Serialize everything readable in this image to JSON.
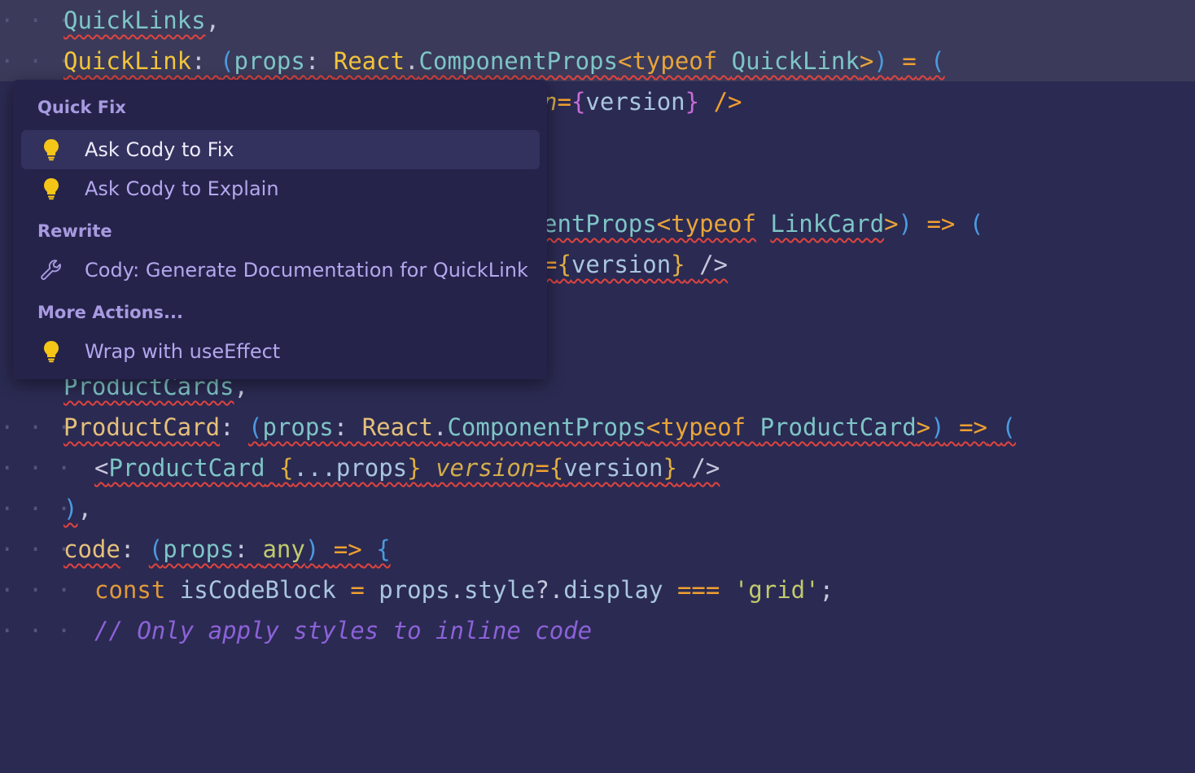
{
  "editor": {
    "lines": [
      {
        "guides": "· · ·  ",
        "code": "QuickLinks,"
      },
      {
        "guides": "· · ·  ",
        "code": "QuickLink: (props: React.ComponentProps<typeof QuickLink>) = ("
      },
      {
        "guides": "",
        "code": "n={version} />"
      },
      {
        "guides": "",
        "code": "entProps<typeof LinkCard>) => ("
      },
      {
        "guides": "",
        "code": "={version} />"
      },
      {
        "guides": "",
        "code": "ProductCards,"
      },
      {
        "guides": "· · · ",
        "code": "ProductCard: (props: React.ComponentProps<typeof ProductCard>) => ("
      },
      {
        "guides": "· · · ",
        "code": "<ProductCard {...props} version={version} />"
      },
      {
        "guides": "· · · ",
        "code": "),"
      },
      {
        "guides": "· · · ",
        "code": "code: (props: any) => {"
      },
      {
        "guides": "· · · ",
        "code": "const isCodeBlock = props.style?.display === 'grid';"
      },
      {
        "guides": "· · · ",
        "code": "// Only apply styles to inline code"
      }
    ]
  },
  "quickfix": {
    "sections": [
      {
        "header": "Quick Fix",
        "items": [
          {
            "label": "Ask Cody to Fix",
            "icon": "lightbulb-icon",
            "selected": true
          },
          {
            "label": "Ask Cody to Explain",
            "icon": "lightbulb-icon",
            "selected": false
          }
        ]
      },
      {
        "header": "Rewrite",
        "items": [
          {
            "label": "Cody: Generate Documentation for QuickLink",
            "icon": "wrench-icon",
            "selected": false
          }
        ]
      },
      {
        "header": "More Actions...",
        "items": [
          {
            "label": "Wrap with useEffect",
            "icon": "lightbulb-icon",
            "selected": false
          }
        ]
      }
    ]
  },
  "colors": {
    "background": "#2b2a52",
    "popup": "#25234a",
    "selected": "#33315e",
    "squiggle": "#e0443e",
    "lightbulb": "#f5c518"
  }
}
